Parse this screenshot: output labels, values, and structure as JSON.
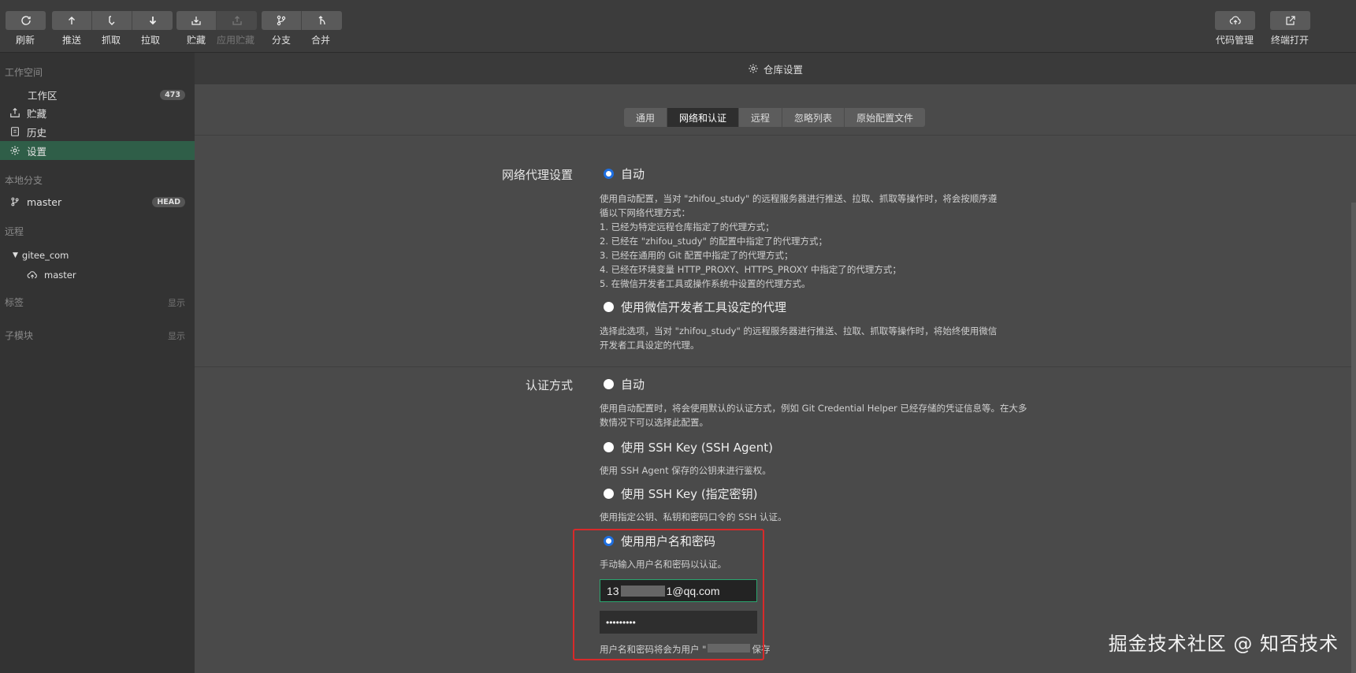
{
  "toolbar": {
    "refresh": "刷新",
    "push": "推送",
    "fetch": "抓取",
    "pull": "拉取",
    "stash": "贮藏",
    "apply_stash": "应用贮藏",
    "branch": "分支",
    "merge": "合并",
    "code_manage": "代码管理",
    "terminal_open": "终端打开"
  },
  "sidebar": {
    "workspace_title": "工作空间",
    "workspace": "工作区",
    "workspace_count": "473",
    "stash": "贮藏",
    "history": "历史",
    "settings": "设置",
    "local_branches_title": "本地分支",
    "local_branch": "master",
    "head_badge": "HEAD",
    "remote_title": "远程",
    "remote_name": "gitee_com",
    "remote_branch": "master",
    "tags_title": "标签",
    "tags_show": "显示",
    "submodules_title": "子模块",
    "submodules_show": "显示"
  },
  "main": {
    "header_title": "仓库设置",
    "tabs": [
      "通用",
      "网络和认证",
      "远程",
      "忽略列表",
      "原始配置文件"
    ],
    "proxy": {
      "label": "网络代理设置",
      "auto": "自动",
      "auto_desc_1": "使用自动配置，当对 \"zhifou_study\" 的远程服务器进行推送、拉取、抓取等操作时，将会按顺序遵",
      "auto_desc_2": "循以下网络代理方式：",
      "auto_desc_3": "1. 已经为特定远程仓库指定了的代理方式；",
      "auto_desc_4": "2. 已经在 \"zhifou_study\" 的配置中指定了的代理方式；",
      "auto_desc_5": "3. 已经在通用的 Git 配置中指定了的代理方式；",
      "auto_desc_6": "4. 已经在环境变量 HTTP_PROXY、HTTPS_PROXY 中指定了的代理方式；",
      "auto_desc_7": "5. 在微信开发者工具或操作系统中设置的代理方式。",
      "wechat": "使用微信开发者工具设定的代理",
      "wechat_desc_1": "选择此选项，当对 \"zhifou_study\" 的远程服务器进行推送、拉取、抓取等操作时，将始终使用微信",
      "wechat_desc_2": "开发者工具设定的代理。"
    },
    "auth": {
      "label": "认证方式",
      "auto": "自动",
      "auto_desc_1": "使用自动配置时，将会使用默认的认证方式，例如 Git Credential Helper 已经存储的凭证信息等。在大多",
      "auto_desc_2": "数情况下可以选择此配置。",
      "ssh_agent": "使用 SSH Key (SSH Agent)",
      "ssh_agent_desc": "使用 SSH Agent 保存的公钥来进行鉴权。",
      "ssh_key": "使用 SSH Key (指定密钥)",
      "ssh_key_desc": "使用指定公钥、私钥和密码口令的 SSH 认证。",
      "userpass": "使用用户名和密码",
      "userpass_desc": "手动输入用户名和密码以认证。",
      "username_prefix": "13",
      "username_suffix": "1@qq.com",
      "password": "•••••••••",
      "save_note_prefix": "用户名和密码将会为用户 \"",
      "save_note_suffix": "保存"
    }
  },
  "watermark": "掘金技术社区 @ 知否技术",
  "colors": {
    "accent_green": "#2f5e48",
    "radio_blue": "#1f6fe0",
    "highlight_red": "#d82a2a"
  }
}
